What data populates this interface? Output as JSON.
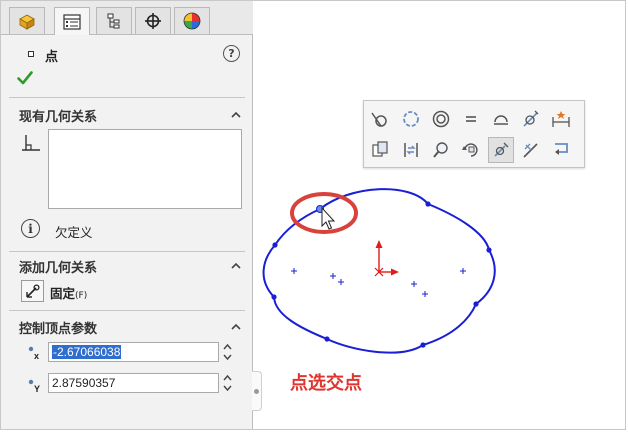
{
  "panel": {
    "tabs": [
      "feature-manager",
      "property-manager",
      "configuration-manager",
      "dimxpert-manager",
      "display-manager"
    ],
    "title": "点",
    "help": "?",
    "sections": {
      "existing_relations": {
        "title": "现有几何关系",
        "info_text": "欠定义"
      },
      "add_relations": {
        "title": "添加几何关系",
        "fix_label": "固定",
        "fix_shortcut": "(F)"
      },
      "parameters": {
        "title": "控制顶点参数",
        "x_sub": "x",
        "y_sub": "Y",
        "x_value": "-2.67066038",
        "y_value": "2.87590357"
      }
    }
  },
  "toolbar": {
    "icons": [
      "tangent-relation-icon",
      "coradial-relation-icon",
      "concentric-relation-icon",
      "equal-relation-icon",
      "merge-relation-icon",
      "coincident-relation-icon",
      "symmetric-relation-icon",
      "copy-entities-icon",
      "move-entities-icon",
      "zoom-to-selection-icon",
      "rotate-view-icon",
      "fix-point-icon",
      "pierce-relation-icon",
      "convert-entities-icon"
    ],
    "selected_index": 11
  },
  "annotation": {
    "callout_text": "点选交点",
    "callout_color": "#e0352f"
  },
  "colors": {
    "spline": "#1a1fd6",
    "origin": "#e21a1a",
    "highlight": "#2f6dcf"
  }
}
